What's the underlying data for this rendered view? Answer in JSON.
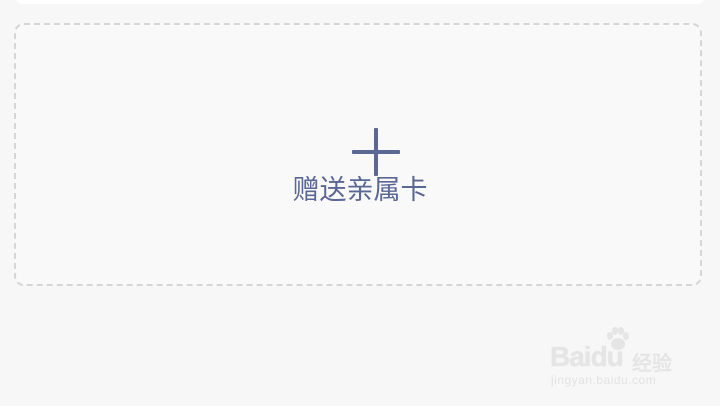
{
  "add_card": {
    "label": "赠送亲属卡",
    "icon": "plus-icon",
    "accent_color": "#5b6794"
  },
  "watermark": {
    "brand": "Bai",
    "brand_suffix": "du",
    "product": "经验",
    "url": "jingyan.baidu.com"
  }
}
